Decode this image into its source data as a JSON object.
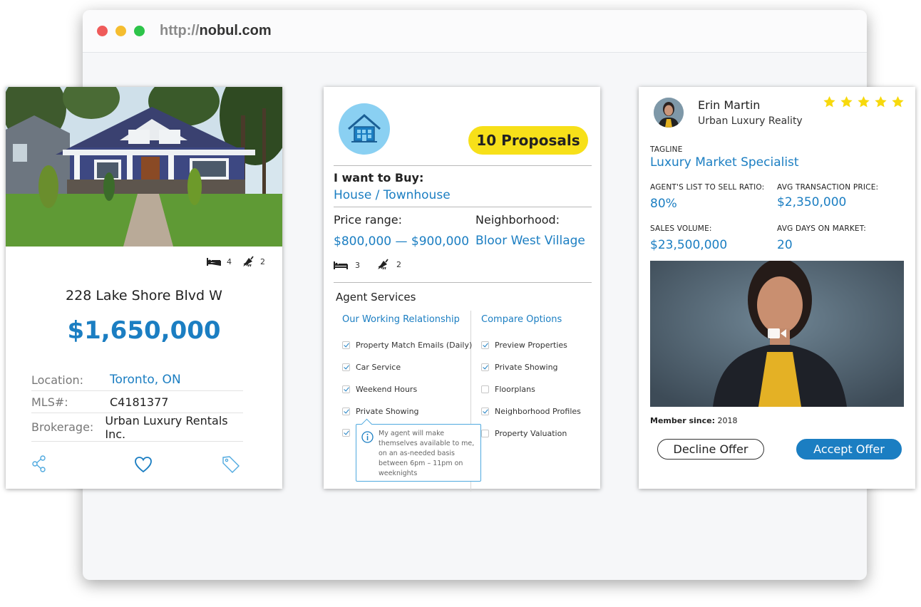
{
  "browser": {
    "url_protocol": "http://",
    "url_host": "nobul.com"
  },
  "listing": {
    "beds": "4",
    "baths": "2",
    "address": "228 Lake Shore Blvd W",
    "price": "$1,650,000",
    "details": [
      {
        "label": "Location:",
        "value": "Toronto, ON"
      },
      {
        "label": "MLS#:",
        "value": "C4181377"
      },
      {
        "label": "Brokerage:",
        "value": "Urban Luxury Rentals Inc."
      }
    ],
    "icons": [
      "share-icon",
      "heart-icon",
      "tag-icon"
    ]
  },
  "request": {
    "proposals": "10 Proposals",
    "want_label": "I want to Buy:",
    "want_value": "House / Townhouse",
    "price_label": "Price range:",
    "price_value": "$800,000 — $900,000",
    "neighborhood_label": "Neighborhood:",
    "neighborhood_value": "Bloor West Village",
    "beds": "3",
    "baths": "2",
    "services_title": "Agent Services",
    "left_col": {
      "title": "Our Working Relationship",
      "items": [
        {
          "label": "Property Match Emails (Daily)",
          "checked": true
        },
        {
          "label": "Car Service",
          "checked": true
        },
        {
          "label": "Weekend Hours",
          "checked": true
        },
        {
          "label": "Private Showing",
          "checked": true
        },
        {
          "label": "",
          "checked": true
        }
      ]
    },
    "right_col": {
      "title": "Compare Options",
      "items": [
        {
          "label": "Preview Properties",
          "checked": true
        },
        {
          "label": "Private Showing",
          "checked": true
        },
        {
          "label": "Floorplans",
          "checked": false
        },
        {
          "label": "Neighborhood Profiles",
          "checked": true
        },
        {
          "label": "Property Valuation",
          "checked": false
        }
      ]
    },
    "tooltip": "My agent will make themselves available to me, on an as-needed basis between 6pm – 11pm on weeknights"
  },
  "agent": {
    "name": "Erin Martin",
    "company": "Urban Luxury Reality",
    "rating": 5,
    "tagline_label": "TAGLINE",
    "tagline": "Luxury Market Specialist",
    "stats": [
      {
        "label": "AGENT'S LIST TO SELL RATIO:",
        "value": "80%"
      },
      {
        "label": "AVG TRANSACTION PRICE:",
        "value": "$2,350,000"
      },
      {
        "label": "SALES VOLUME:",
        "value": "$23,500,000"
      },
      {
        "label": "AVG DAYS ON MARKET:",
        "value": "20"
      }
    ],
    "member_label": "Member since:",
    "member_year": "2018",
    "decline_label": "Decline Offer",
    "accept_label": "Accept Offer",
    "colors": {
      "accent": "#1b7ec2",
      "star": "#f7d90c",
      "badge": "#f7e019"
    }
  }
}
